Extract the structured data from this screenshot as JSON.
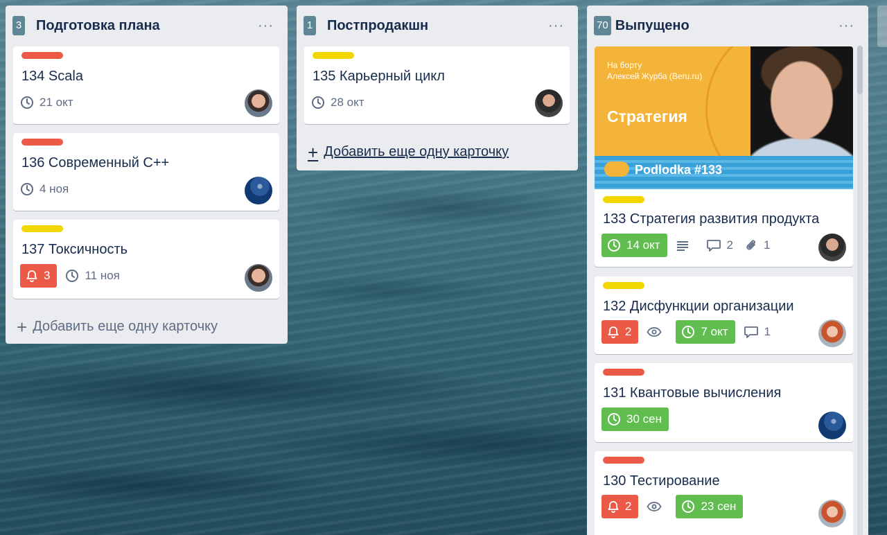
{
  "lists": [
    {
      "count": "3",
      "title": "Подготовка плана",
      "menu": "···",
      "add_card": "Добавить еще одну карточку",
      "cards": [
        {
          "label_color": "#eb5a46",
          "title": "134 Scala",
          "due": "21 окт"
        },
        {
          "label_color": "#eb5a46",
          "title": "136 Современный C++",
          "due": "4 ноя"
        },
        {
          "label_color": "#f2d600",
          "title": "137 Токсичность",
          "notifications": "3",
          "due": "11 ноя"
        }
      ]
    },
    {
      "count": "1",
      "title": "Постпродакшн",
      "menu": "···",
      "add_card": "Добавить еще одну карточку",
      "cards": [
        {
          "label_color": "#f2d600",
          "title": "135 Карьерный цикл",
          "due": "28 окт"
        }
      ]
    },
    {
      "count": "70",
      "title": "Выпущено",
      "menu": "···",
      "cover": {
        "kicker": "На борту",
        "guest": "Алексей Журба (Beru.ru)",
        "topic": "Стратегия",
        "podcast": "Podlodka #133",
        "bg_color": "#f4b43a"
      },
      "cards": [
        {
          "label_color": "#f2d600",
          "title": "133 Стратегия развития продукта",
          "due": "14 окт",
          "comments": "2",
          "attachments": "1"
        },
        {
          "label_color": "#f2d600",
          "title": "132 Дисфункции организации",
          "notifications": "2",
          "due": "7 окт",
          "comments": "1"
        },
        {
          "label_color": "#eb5a46",
          "title": "131 Квантовые вычисления",
          "due": "30 сен"
        },
        {
          "label_color": "#eb5a46",
          "title": "130 Тестирование",
          "notifications": "2",
          "due": "23 сен"
        }
      ]
    }
  ],
  "colors": {
    "red": "#eb5a46",
    "yellow": "#f2d600",
    "green": "#61bd4f",
    "list_bg": "#ebecf0"
  },
  "icons": [
    "clock-icon",
    "bell-icon",
    "eye-icon",
    "description-icon",
    "comment-icon",
    "paperclip-icon",
    "plus-icon",
    "more-icon"
  ]
}
